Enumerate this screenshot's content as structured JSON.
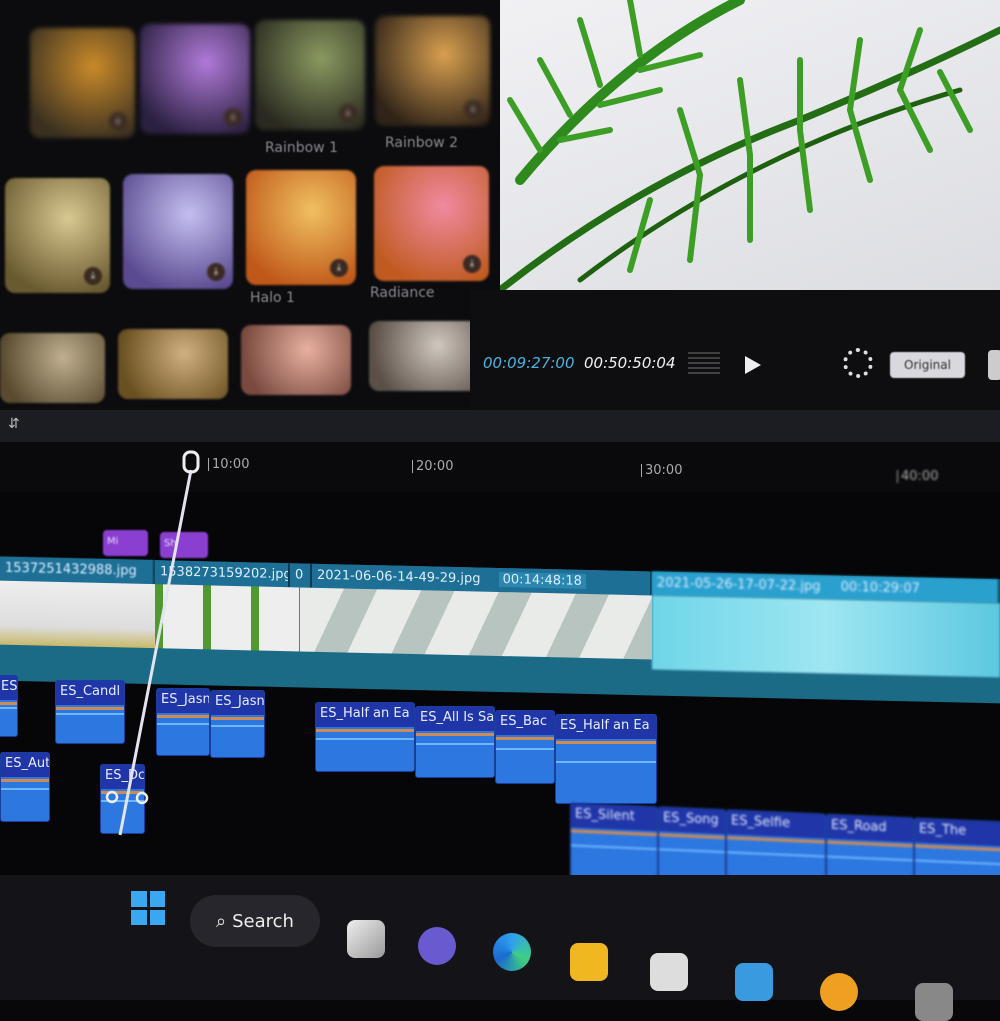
{
  "effects": {
    "items": [
      {
        "label": "",
        "colors": [
          "#3a3020",
          "#c98a2a"
        ]
      },
      {
        "label": "",
        "colors": [
          "#2a2040",
          "#b07ad8"
        ]
      },
      {
        "label": "Rainbow 1",
        "colors": [
          "#2a2a20",
          "#8a9a60"
        ]
      },
      {
        "label": "Rainbow 2",
        "colors": [
          "#302418",
          "#d9a050"
        ]
      },
      {
        "label": "",
        "colors": [
          "#6a5a30",
          "#d8c890"
        ]
      },
      {
        "label": "",
        "colors": [
          "#5a4a90",
          "#c4bff0"
        ]
      },
      {
        "label": "Halo 1",
        "colors": [
          "#c0581a",
          "#f0c060"
        ]
      },
      {
        "label": "Radiance",
        "colors": [
          "#c05a20",
          "#f08aa0"
        ]
      },
      {
        "label": "",
        "colors": [
          "#5a4a30",
          "#c0b090"
        ]
      },
      {
        "label": "",
        "colors": [
          "#6a5020",
          "#d0b080"
        ]
      },
      {
        "label": "",
        "colors": [
          "#7a4a40",
          "#e8b0a0"
        ]
      },
      {
        "label": "",
        "colors": [
          "#5a5048",
          "#d0c8c0"
        ]
      }
    ],
    "download_icon": "download-icon"
  },
  "player": {
    "current_time": "00:09:27:00",
    "total_time": "00:50:50:04",
    "play_icon": "play-icon",
    "fullscreen_icon": "fullscreen-icon",
    "ratio_label": "Original",
    "accent": "#4ab3e0"
  },
  "ruler": {
    "ticks": [
      "10:00",
      "20:00",
      "30:00",
      "40:00"
    ]
  },
  "timeline": {
    "effect_clips": [
      "Mi",
      "Sh"
    ],
    "video_clips": [
      {
        "name": "1537251432988.jpg",
        "duration": ""
      },
      {
        "name": "1538273159202.jpg",
        "duration": ""
      },
      {
        "name": "0",
        "duration": ""
      },
      {
        "name": "2021-06-06-14-49-29.jpg",
        "duration": "00:14:48:18"
      },
      {
        "name": "2021-05-26-17-07-22.jpg",
        "duration": "00:10:29:07"
      }
    ],
    "audio_clips": [
      "ES_Lu",
      "ES_Candl",
      "ES_Jasn",
      "ES_Jasn",
      "ES_Half an Ea",
      "ES_All Is Sa",
      "ES_Bac",
      "ES_Half an Ea",
      "ES_Aut",
      "ES_Dc",
      "ES_Silent",
      "ES_Song",
      "ES_Selfie",
      "ES_Road",
      "ES_The"
    ],
    "audio_color": "#2c77e0",
    "video_color": "#1e6f96"
  },
  "taskbar": {
    "search_label": "Search",
    "icons": [
      "windows-start-icon",
      "task-view-icon",
      "chat-icon",
      "edge-icon",
      "file-explorer-icon",
      "photos-icon",
      "store-icon",
      "app-icon",
      "app-icon-2"
    ]
  }
}
